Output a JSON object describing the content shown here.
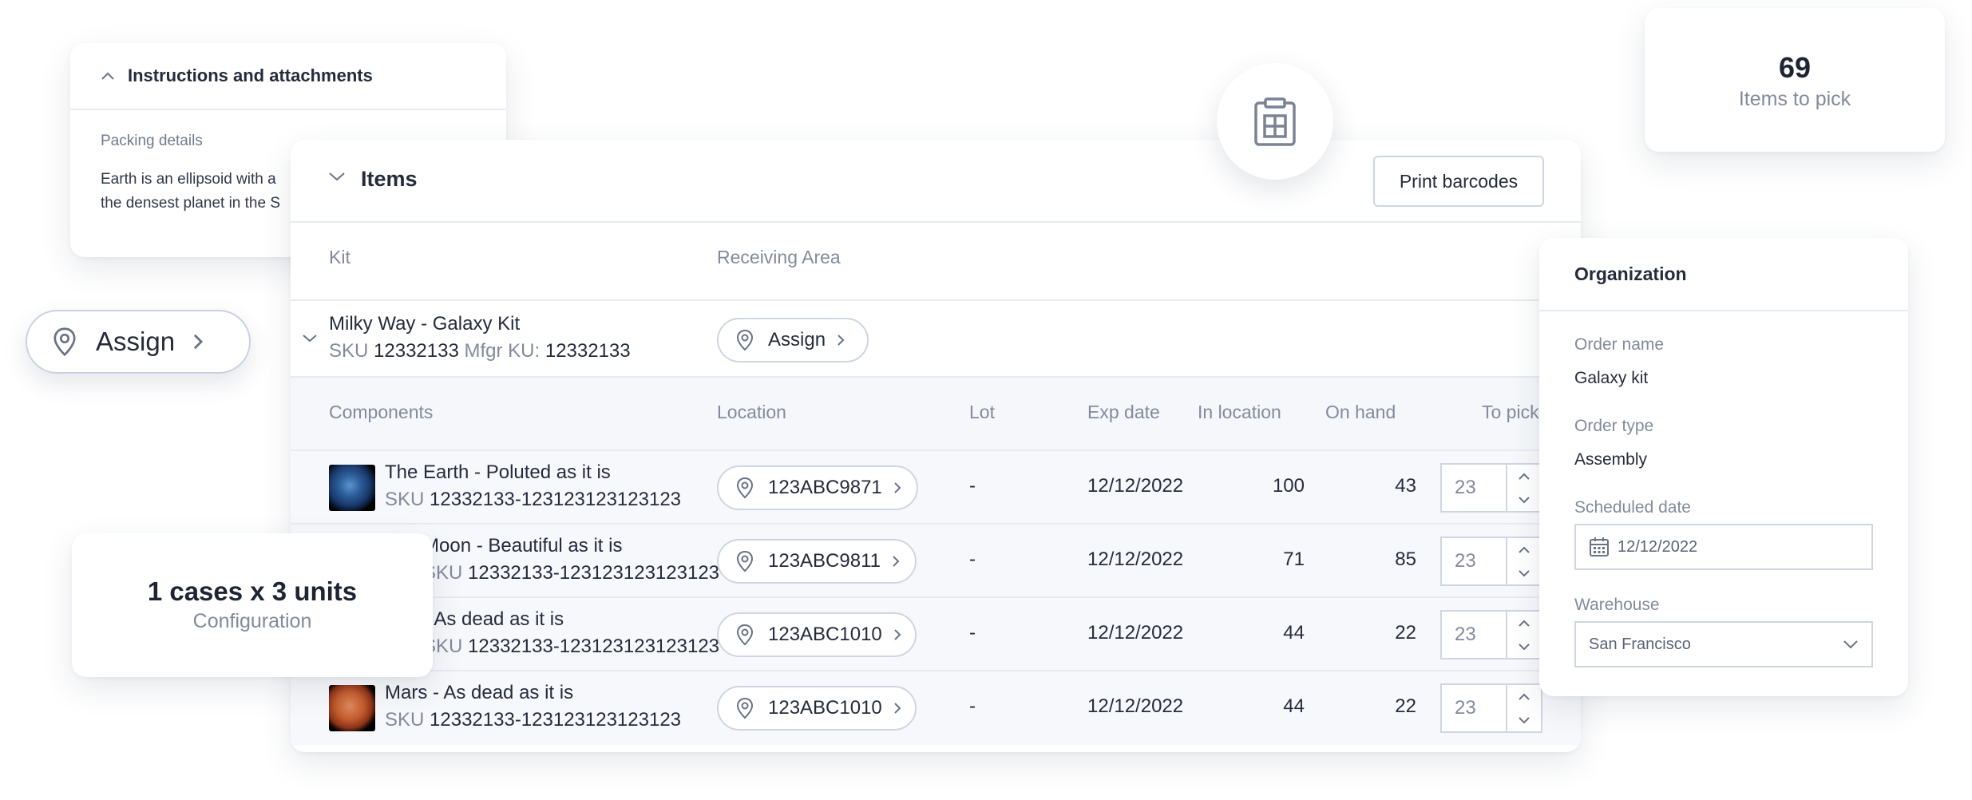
{
  "instructions": {
    "title": "Instructions and attachments",
    "packing_label": "Packing details",
    "text_line1": "Earth is an ellipsoid with a",
    "text_line2": "the densest planet in the S"
  },
  "items_panel": {
    "title": "Items",
    "print_button": "Print barcodes",
    "kit_header": "Kit",
    "receiving_header": "Receiving Area",
    "kit": {
      "name": "Milky Way - Galaxy Kit",
      "sku_label": "SKU",
      "sku": "12332133",
      "mfgr_label": "Mfgr KU:",
      "mfgr": "12332133",
      "assign_label": "Assign"
    },
    "columns": {
      "components": "Components",
      "location": "Location",
      "lot": "Lot",
      "exp_date": "Exp date",
      "in_location": "In location",
      "on_hand": "On hand",
      "to_pick": "To pick"
    },
    "rows": [
      {
        "name": "The Earth - Poluted as it is",
        "sku_label": "SKU",
        "sku": "12332133-123123123123123",
        "location": "123ABC9871",
        "lot": "-",
        "exp": "12/12/2022",
        "in_location": "100",
        "on_hand": "43",
        "to_pick": "23"
      },
      {
        "name": "Moon - Beautiful as it is",
        "sku_label": "SKU",
        "sku": "12332133-123123123123123",
        "location": "123ABC9811",
        "lot": "-",
        "exp": "12/12/2022",
        "in_location": "71",
        "on_hand": "85",
        "to_pick": "23"
      },
      {
        "name": "- As dead as it is",
        "sku_label": "SKU",
        "sku": "12332133-123123123123123",
        "location": "123ABC1010",
        "lot": "-",
        "exp": "12/12/2022",
        "in_location": "44",
        "on_hand": "22",
        "to_pick": "23"
      },
      {
        "name": "Mars - As dead as it is",
        "sku_label": "SKU",
        "sku": "12332133-123123123123123",
        "location": "123ABC1010",
        "lot": "-",
        "exp": "12/12/2022",
        "in_location": "44",
        "on_hand": "22",
        "to_pick": "23"
      }
    ]
  },
  "pick": {
    "count": "69",
    "label": "Items to pick"
  },
  "assign_float": {
    "label": "Assign"
  },
  "config": {
    "value": "1 cases x 3 units",
    "label": "Configuration"
  },
  "organization": {
    "title": "Organization",
    "order_name_label": "Order name",
    "order_name": "Galaxy kit",
    "order_type_label": "Order type",
    "order_type": "Assembly",
    "scheduled_label": "Scheduled date",
    "scheduled_value": "12/12/2022",
    "warehouse_label": "Warehouse",
    "warehouse_value": "San Francisco"
  },
  "colors": {
    "border": "#cfd5e1",
    "muted_text": "#838a9b",
    "row_bg": "#f7f8fb",
    "text": "#262b3c"
  }
}
